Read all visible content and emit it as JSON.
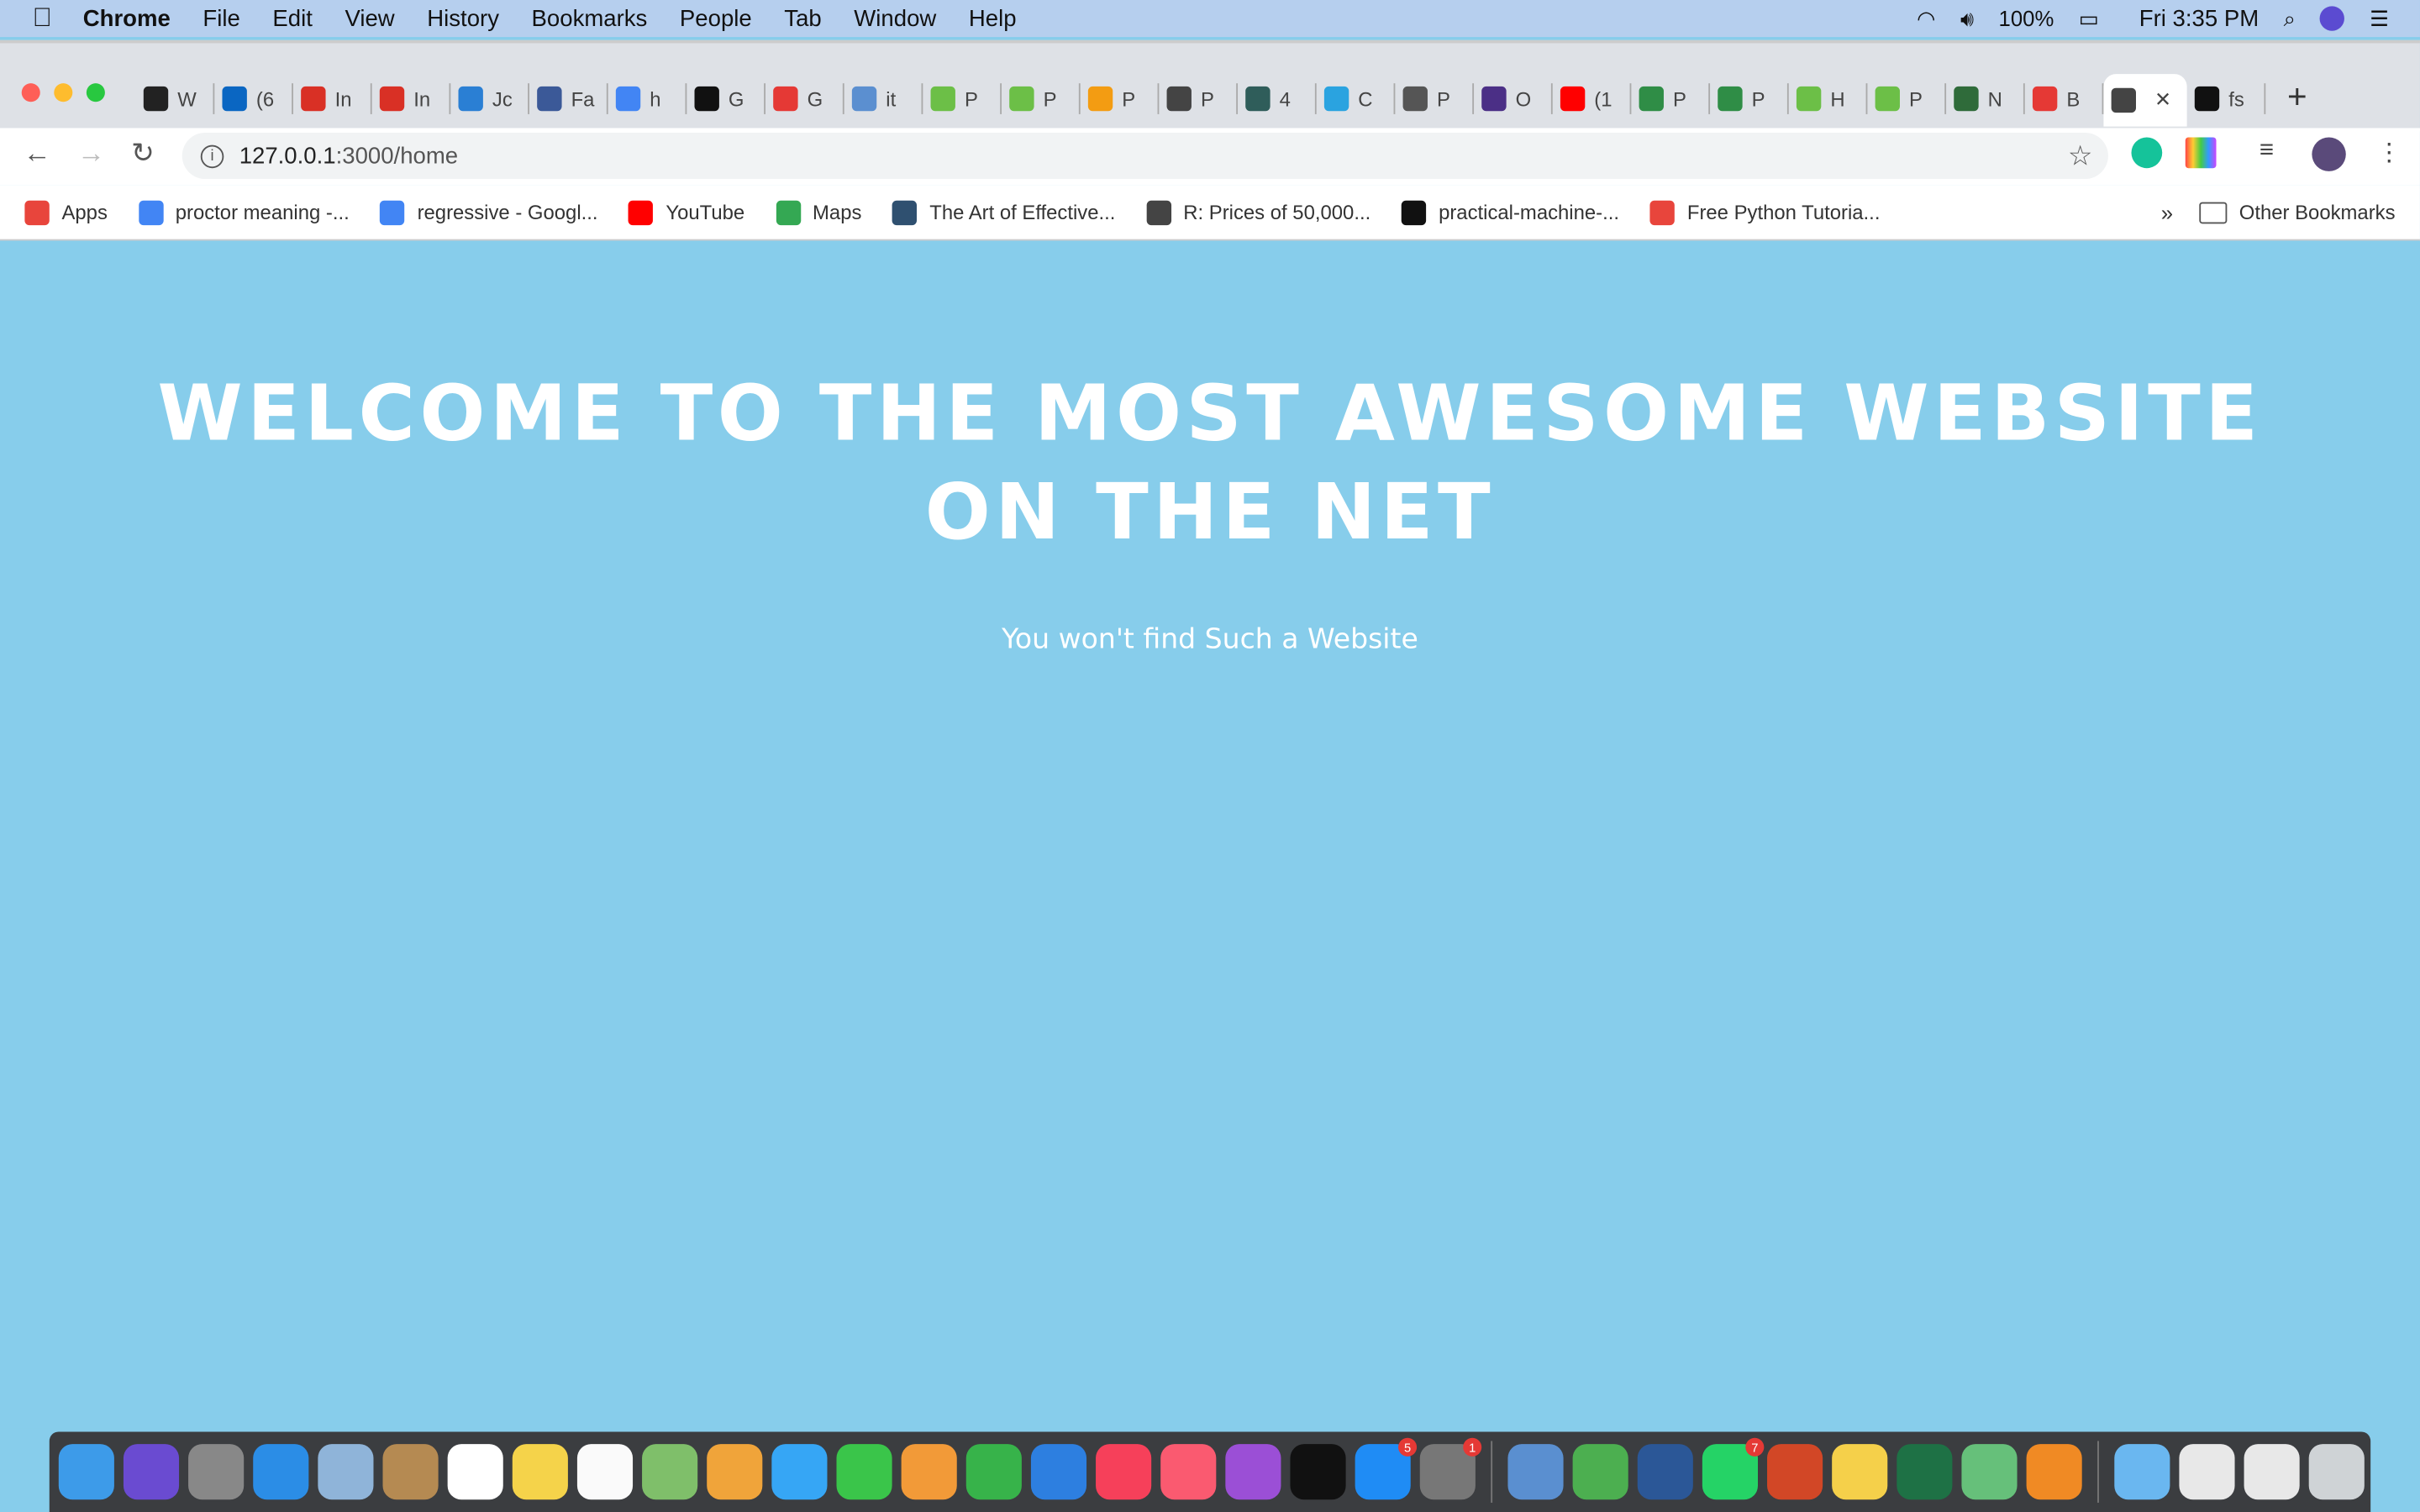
{
  "menubar": {
    "app": "Chrome",
    "items": [
      "File",
      "Edit",
      "View",
      "History",
      "Bookmarks",
      "People",
      "Tab",
      "Window",
      "Help"
    ],
    "battery": "100%",
    "clock": "Fri 3:35 PM"
  },
  "tabs": [
    {
      "letter": "W",
      "icon": "amazon-icon",
      "color": "#222"
    },
    {
      "letter": "(6",
      "icon": "linkedin-icon",
      "color": "#0a66c2"
    },
    {
      "letter": "In",
      "icon": "gmail-icon",
      "color": "#d93025"
    },
    {
      "letter": "In",
      "icon": "gmail-icon",
      "color": "#d93025"
    },
    {
      "letter": "Jc",
      "icon": "w-logo-icon",
      "color": "#2a7fd4"
    },
    {
      "letter": "Fa",
      "icon": "facebook-icon",
      "color": "#3b5998"
    },
    {
      "letter": "h",
      "icon": "google-icon",
      "color": "#4285f4"
    },
    {
      "letter": "G",
      "icon": "github-icon",
      "color": "#111"
    },
    {
      "letter": "G",
      "icon": "globe-red-icon",
      "color": "#e53935"
    },
    {
      "letter": "it",
      "icon": "chart-icon",
      "color": "#5b8fd0"
    },
    {
      "letter": "P",
      "icon": "w3schools-icon",
      "color": "#6cbf47"
    },
    {
      "letter": "P",
      "icon": "w3schools-icon",
      "color": "#6cbf47"
    },
    {
      "letter": "P",
      "icon": "code-icon",
      "color": "#f39c12"
    },
    {
      "letter": "P",
      "icon": "globe-icon",
      "color": "#444"
    },
    {
      "letter": "4",
      "icon": "rsi-icon",
      "color": "#2f5d5a"
    },
    {
      "letter": "C",
      "icon": "ring-icon",
      "color": "#2aa3e0"
    },
    {
      "letter": "P",
      "icon": "folder-icon",
      "color": "#555"
    },
    {
      "letter": "O",
      "icon": "bolt-icon",
      "color": "#4b2f86"
    },
    {
      "letter": "(1",
      "icon": "youtube-icon",
      "color": "#ff0000"
    },
    {
      "letter": "P",
      "icon": "geeksforgeeks-icon",
      "color": "#2f8d46"
    },
    {
      "letter": "P",
      "icon": "geeksforgeeks-icon",
      "color": "#2f8d46"
    },
    {
      "letter": "H",
      "icon": "w3schools-icon",
      "color": "#6cbf47"
    },
    {
      "letter": "P",
      "icon": "w3schools-icon",
      "color": "#6cbf47"
    },
    {
      "letter": "N",
      "icon": "diamond-icon",
      "color": "#2f6b3a"
    },
    {
      "letter": "B",
      "icon": "globe-red-icon",
      "color": "#e53935"
    },
    {
      "letter": "",
      "icon": "globe-icon",
      "color": "#444",
      "active": true
    },
    {
      "letter": "fs",
      "icon": "github-icon",
      "color": "#111"
    }
  ],
  "address": {
    "host": "127.0.0.1",
    "rest": ":3000/home"
  },
  "bookmarks": [
    {
      "label": "Apps",
      "icon": "apps-grid-icon",
      "color": "#e8453c"
    },
    {
      "label": "proctor meaning -...",
      "icon": "google-icon",
      "color": "#4285f4"
    },
    {
      "label": "regressive - Googl...",
      "icon": "google-icon",
      "color": "#4285f4"
    },
    {
      "label": "YouTube",
      "icon": "youtube-icon",
      "color": "#ff0000"
    },
    {
      "label": "Maps",
      "icon": "maps-icon",
      "color": "#34a853"
    },
    {
      "label": "The Art of Effective...",
      "icon": "book-icon",
      "color": "#2f5070"
    },
    {
      "label": "R: Prices of 50,000...",
      "icon": "globe-icon",
      "color": "#444"
    },
    {
      "label": "practical-machine-...",
      "icon": "github-icon",
      "color": "#111"
    },
    {
      "label": "Free Python Tutoria...",
      "icon": "udemy-icon",
      "color": "#e8453c"
    }
  ],
  "other_bookmarks": "Other Bookmarks",
  "page": {
    "heading": "WELCOME TO THE MOST AWESOME WEBSITE ON THE NET",
    "subheading": "You won't find Such a Website",
    "background": "#87CDEB"
  },
  "dock": [
    {
      "icon": "finder-icon",
      "color": "#3d9be9"
    },
    {
      "icon": "siri-icon",
      "color": "#6a4bd1"
    },
    {
      "icon": "launchpad-icon",
      "color": "#888"
    },
    {
      "icon": "safari-icon",
      "color": "#2b8de6"
    },
    {
      "icon": "mail-icon",
      "color": "#8fb4d9"
    },
    {
      "icon": "contacts-icon",
      "color": "#b58a52"
    },
    {
      "icon": "calendar-icon",
      "color": "#ffffff"
    },
    {
      "icon": "notes-icon",
      "color": "#f5d34a"
    },
    {
      "icon": "reminders-icon",
      "color": "#fafafa"
    },
    {
      "icon": "maps-icon",
      "color": "#7fbf6a"
    },
    {
      "icon": "photos-icon",
      "color": "#f0a43a"
    },
    {
      "icon": "messages-icon",
      "color": "#36a6f5"
    },
    {
      "icon": "facetime-icon",
      "color": "#3ac54a"
    },
    {
      "icon": "pages-icon",
      "color": "#f29a38"
    },
    {
      "icon": "numbers-icon",
      "color": "#37b34a"
    },
    {
      "icon": "keynote-icon",
      "color": "#2d7fe0"
    },
    {
      "icon": "news-icon",
      "color": "#f6405a"
    },
    {
      "icon": "music-icon",
      "color": "#fa5a70"
    },
    {
      "icon": "podcasts-icon",
      "color": "#9b4fd6"
    },
    {
      "icon": "apple-tv-icon",
      "color": "#111"
    },
    {
      "icon": "app-store-icon",
      "color": "#1f8cf5",
      "badge": "5"
    },
    {
      "icon": "system-preferences-icon",
      "color": "#777",
      "badge": "1"
    },
    {
      "sep": true
    },
    {
      "icon": "virtualbox-icon",
      "color": "#5a8fd0"
    },
    {
      "icon": "chrome-icon",
      "color": "#4caf50"
    },
    {
      "icon": "word-icon",
      "color": "#2b5797"
    },
    {
      "icon": "whatsapp-icon",
      "color": "#25d366",
      "badge": "7"
    },
    {
      "icon": "powerpoint-icon",
      "color": "#d24726"
    },
    {
      "icon": "python-icon",
      "color": "#f5d04a"
    },
    {
      "icon": "excel-icon",
      "color": "#1e7145"
    },
    {
      "icon": "atom-icon",
      "color": "#66c07a"
    },
    {
      "icon": "sublime-icon",
      "color": "#f08a24"
    },
    {
      "sep": true
    },
    {
      "icon": "folder-icon",
      "color": "#6ab7f0"
    },
    {
      "icon": "document-icon",
      "color": "#e8e8e8"
    },
    {
      "icon": "document-icon",
      "color": "#e8e8e8"
    },
    {
      "icon": "trash-icon",
      "color": "#cfd3d6"
    }
  ]
}
